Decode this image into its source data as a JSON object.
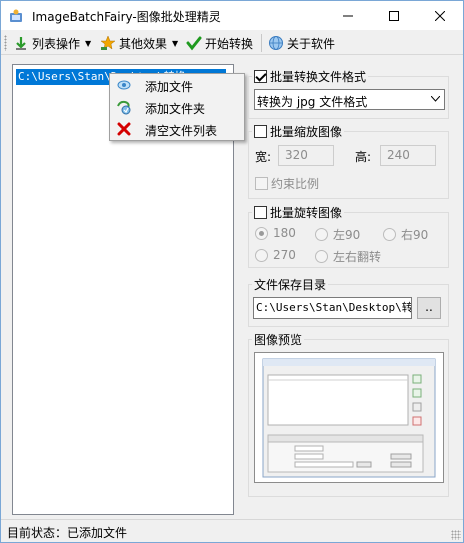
{
  "window": {
    "title": "ImageBatchFairy-图像批处理精灵"
  },
  "toolbar": {
    "list_ops_label": "列表操作",
    "effects_label": "其他效果",
    "start_label": "开始转换",
    "about_label": "关于软件"
  },
  "file_list": {
    "items": [
      "C:\\Users\\Stan\\Desktop\\转换"
    ]
  },
  "context_menu": {
    "items": [
      {
        "label": "添加文件",
        "icon": "add-file-icon"
      },
      {
        "label": "添加文件夹",
        "icon": "add-folder-icon"
      },
      {
        "label": "清空文件列表",
        "icon": "clear-list-icon"
      }
    ]
  },
  "format_group": {
    "title": "批量转换文件格式",
    "checked": true,
    "selected": "转换为 jpg 文件格式"
  },
  "resize_group": {
    "title": "批量缩放图像",
    "checked": false,
    "width_label": "宽:",
    "width_value": "320",
    "height_label": "高:",
    "height_value": "240",
    "ratio_label": "约束比例"
  },
  "rotate_group": {
    "title": "批量旋转图像",
    "checked": false,
    "options": [
      "180",
      "左90",
      "右90",
      "270",
      "左右翻转"
    ],
    "selected": "180"
  },
  "output_group": {
    "title": "文件保存目录",
    "path": "C:\\Users\\Stan\\Desktop\\转换",
    "browse_label": ".."
  },
  "preview_group": {
    "title": "图像预览"
  },
  "status": {
    "text": "目前状态：已添加文件"
  },
  "colors": {
    "selection": "#0078d7",
    "window_bg": "#f0f0f0",
    "clear_icon": "#d40000"
  }
}
